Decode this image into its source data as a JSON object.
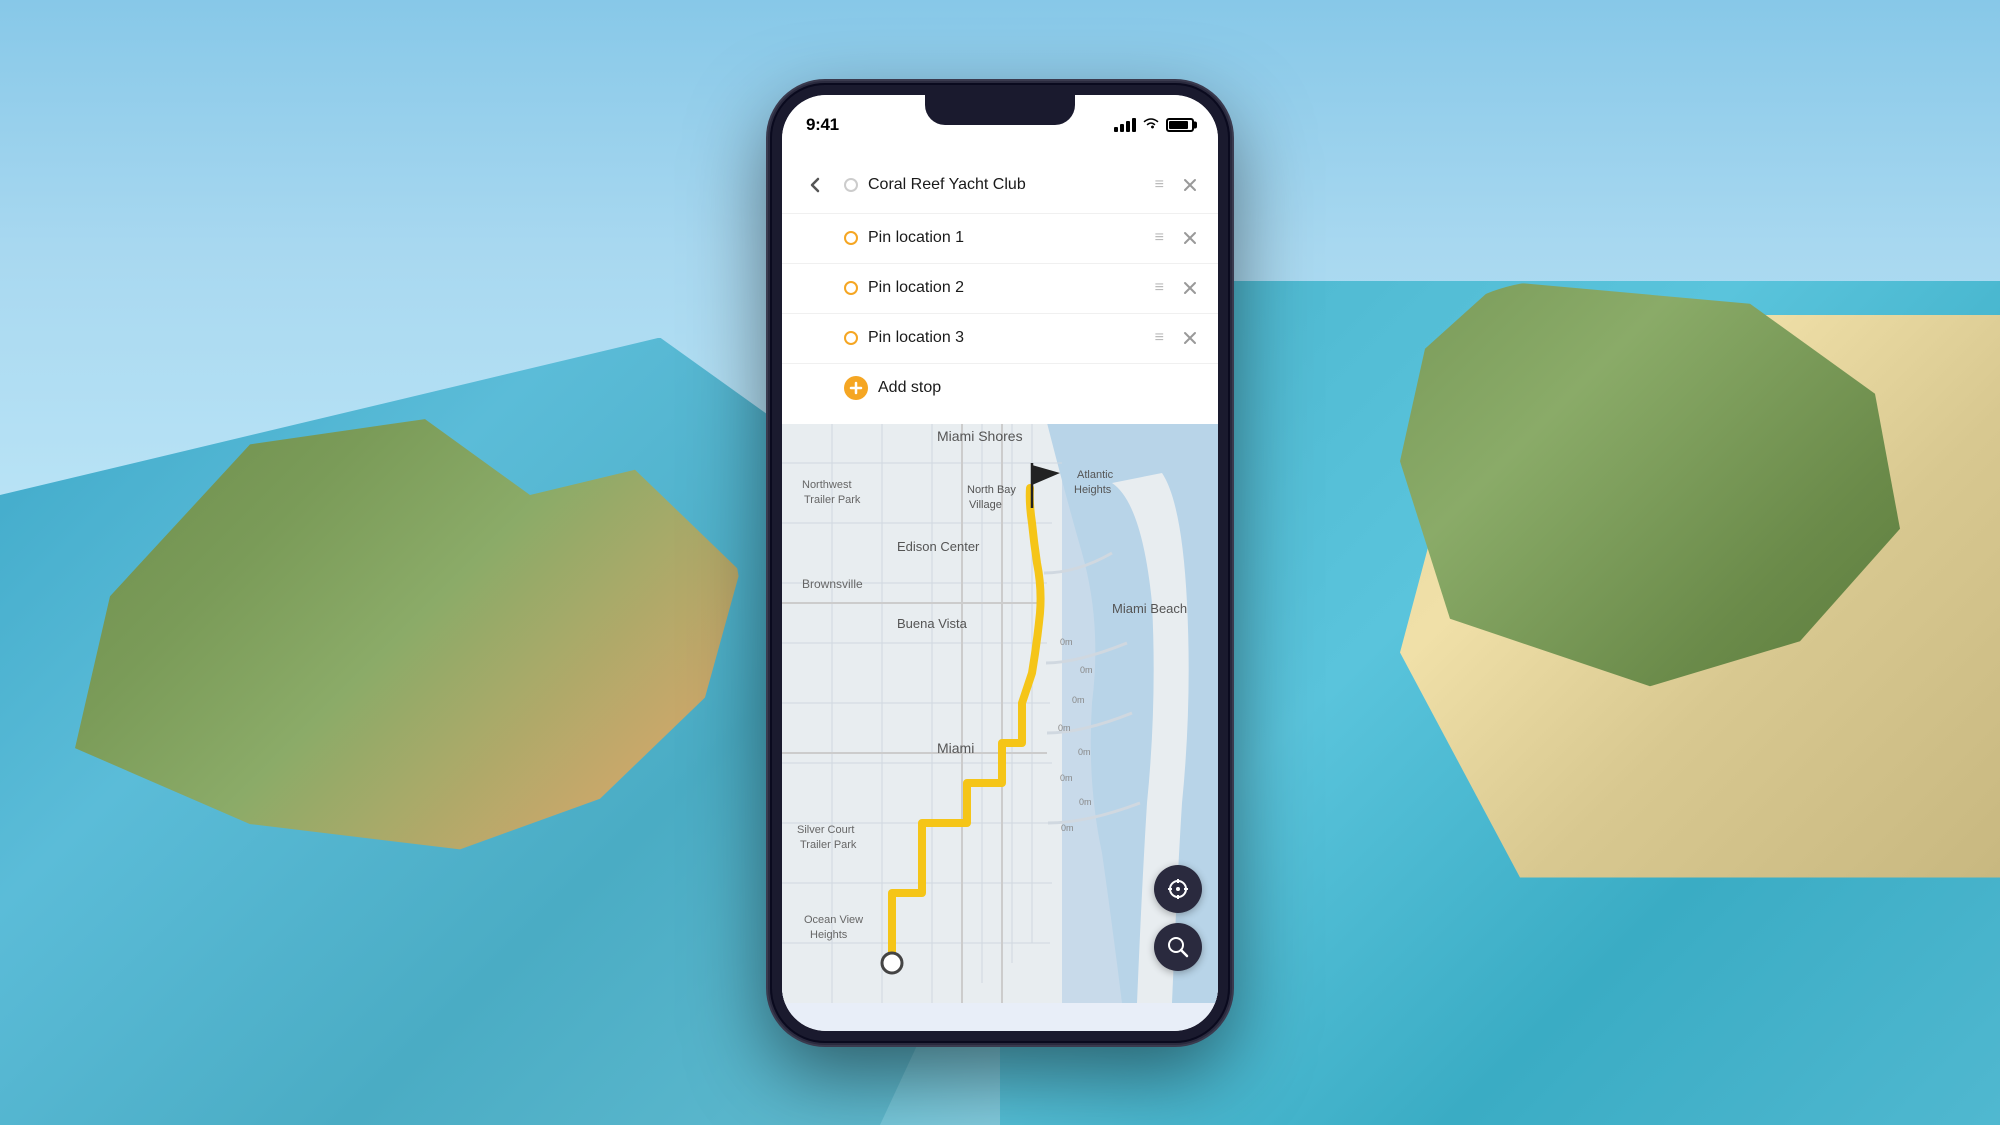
{
  "background": {
    "sky_color": "#87C8E8",
    "water_color": "#4AB4CC"
  },
  "phone": {
    "status_bar": {
      "time": "9:41",
      "signal_label": "signal",
      "wifi_label": "wifi",
      "battery_label": "battery"
    }
  },
  "route_panel": {
    "back_label": "←",
    "destination": {
      "label": "Coral Reef Yacht Club",
      "dot_type": "empty"
    },
    "stops": [
      {
        "label": "Pin location 1",
        "dot_type": "yellow"
      },
      {
        "label": "Pin location 2",
        "dot_type": "yellow"
      },
      {
        "label": "Pin location 3",
        "dot_type": "yellow"
      }
    ],
    "add_stop": "Add stop"
  },
  "map": {
    "labels": [
      "Miami Shores",
      "Northwest Trailer Park",
      "North Bay Village",
      "Atlantic Heights",
      "Edison Center",
      "Brownsville",
      "Buena Vista",
      "Silver Court Trailer Park",
      "Miami",
      "Miami Beach",
      "Ocean View Heights"
    ],
    "distance_labels": [
      "0m",
      "0m",
      "0m",
      "0m",
      "0m",
      "0m",
      "0m",
      "0m"
    ]
  },
  "map_controls": {
    "crosshair_label": "⊕",
    "search_label": "⌕"
  },
  "icons": {
    "drag_handle": "≡",
    "close": "×",
    "add": "+",
    "back_arrow": "←"
  }
}
